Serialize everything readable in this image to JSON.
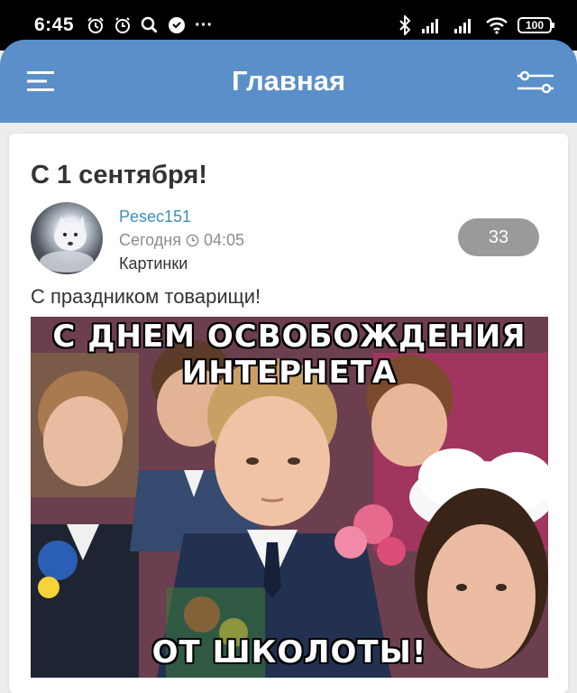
{
  "status_bar": {
    "time": "6:45",
    "battery": "100",
    "more": "···"
  },
  "header": {
    "title": "Главная"
  },
  "post": {
    "title": "С 1 сентября!",
    "author": "Pesec151",
    "date_label": "Сегодня",
    "time": "04:05",
    "category": "Картинки",
    "comments_count": "33",
    "text": "С праздником товарищи!",
    "image": {
      "caption_top_line1": "С ДНЕМ ОСВОБОЖДЕНИЯ",
      "caption_top_line2": "ИНТЕРНЕТА",
      "caption_bottom": "ОТ ШКОЛОТЫ!"
    }
  },
  "colors": {
    "header_bg": "#5b8fc9",
    "author_link": "#3f8fb5",
    "badge_bg": "#9a9a9a"
  }
}
